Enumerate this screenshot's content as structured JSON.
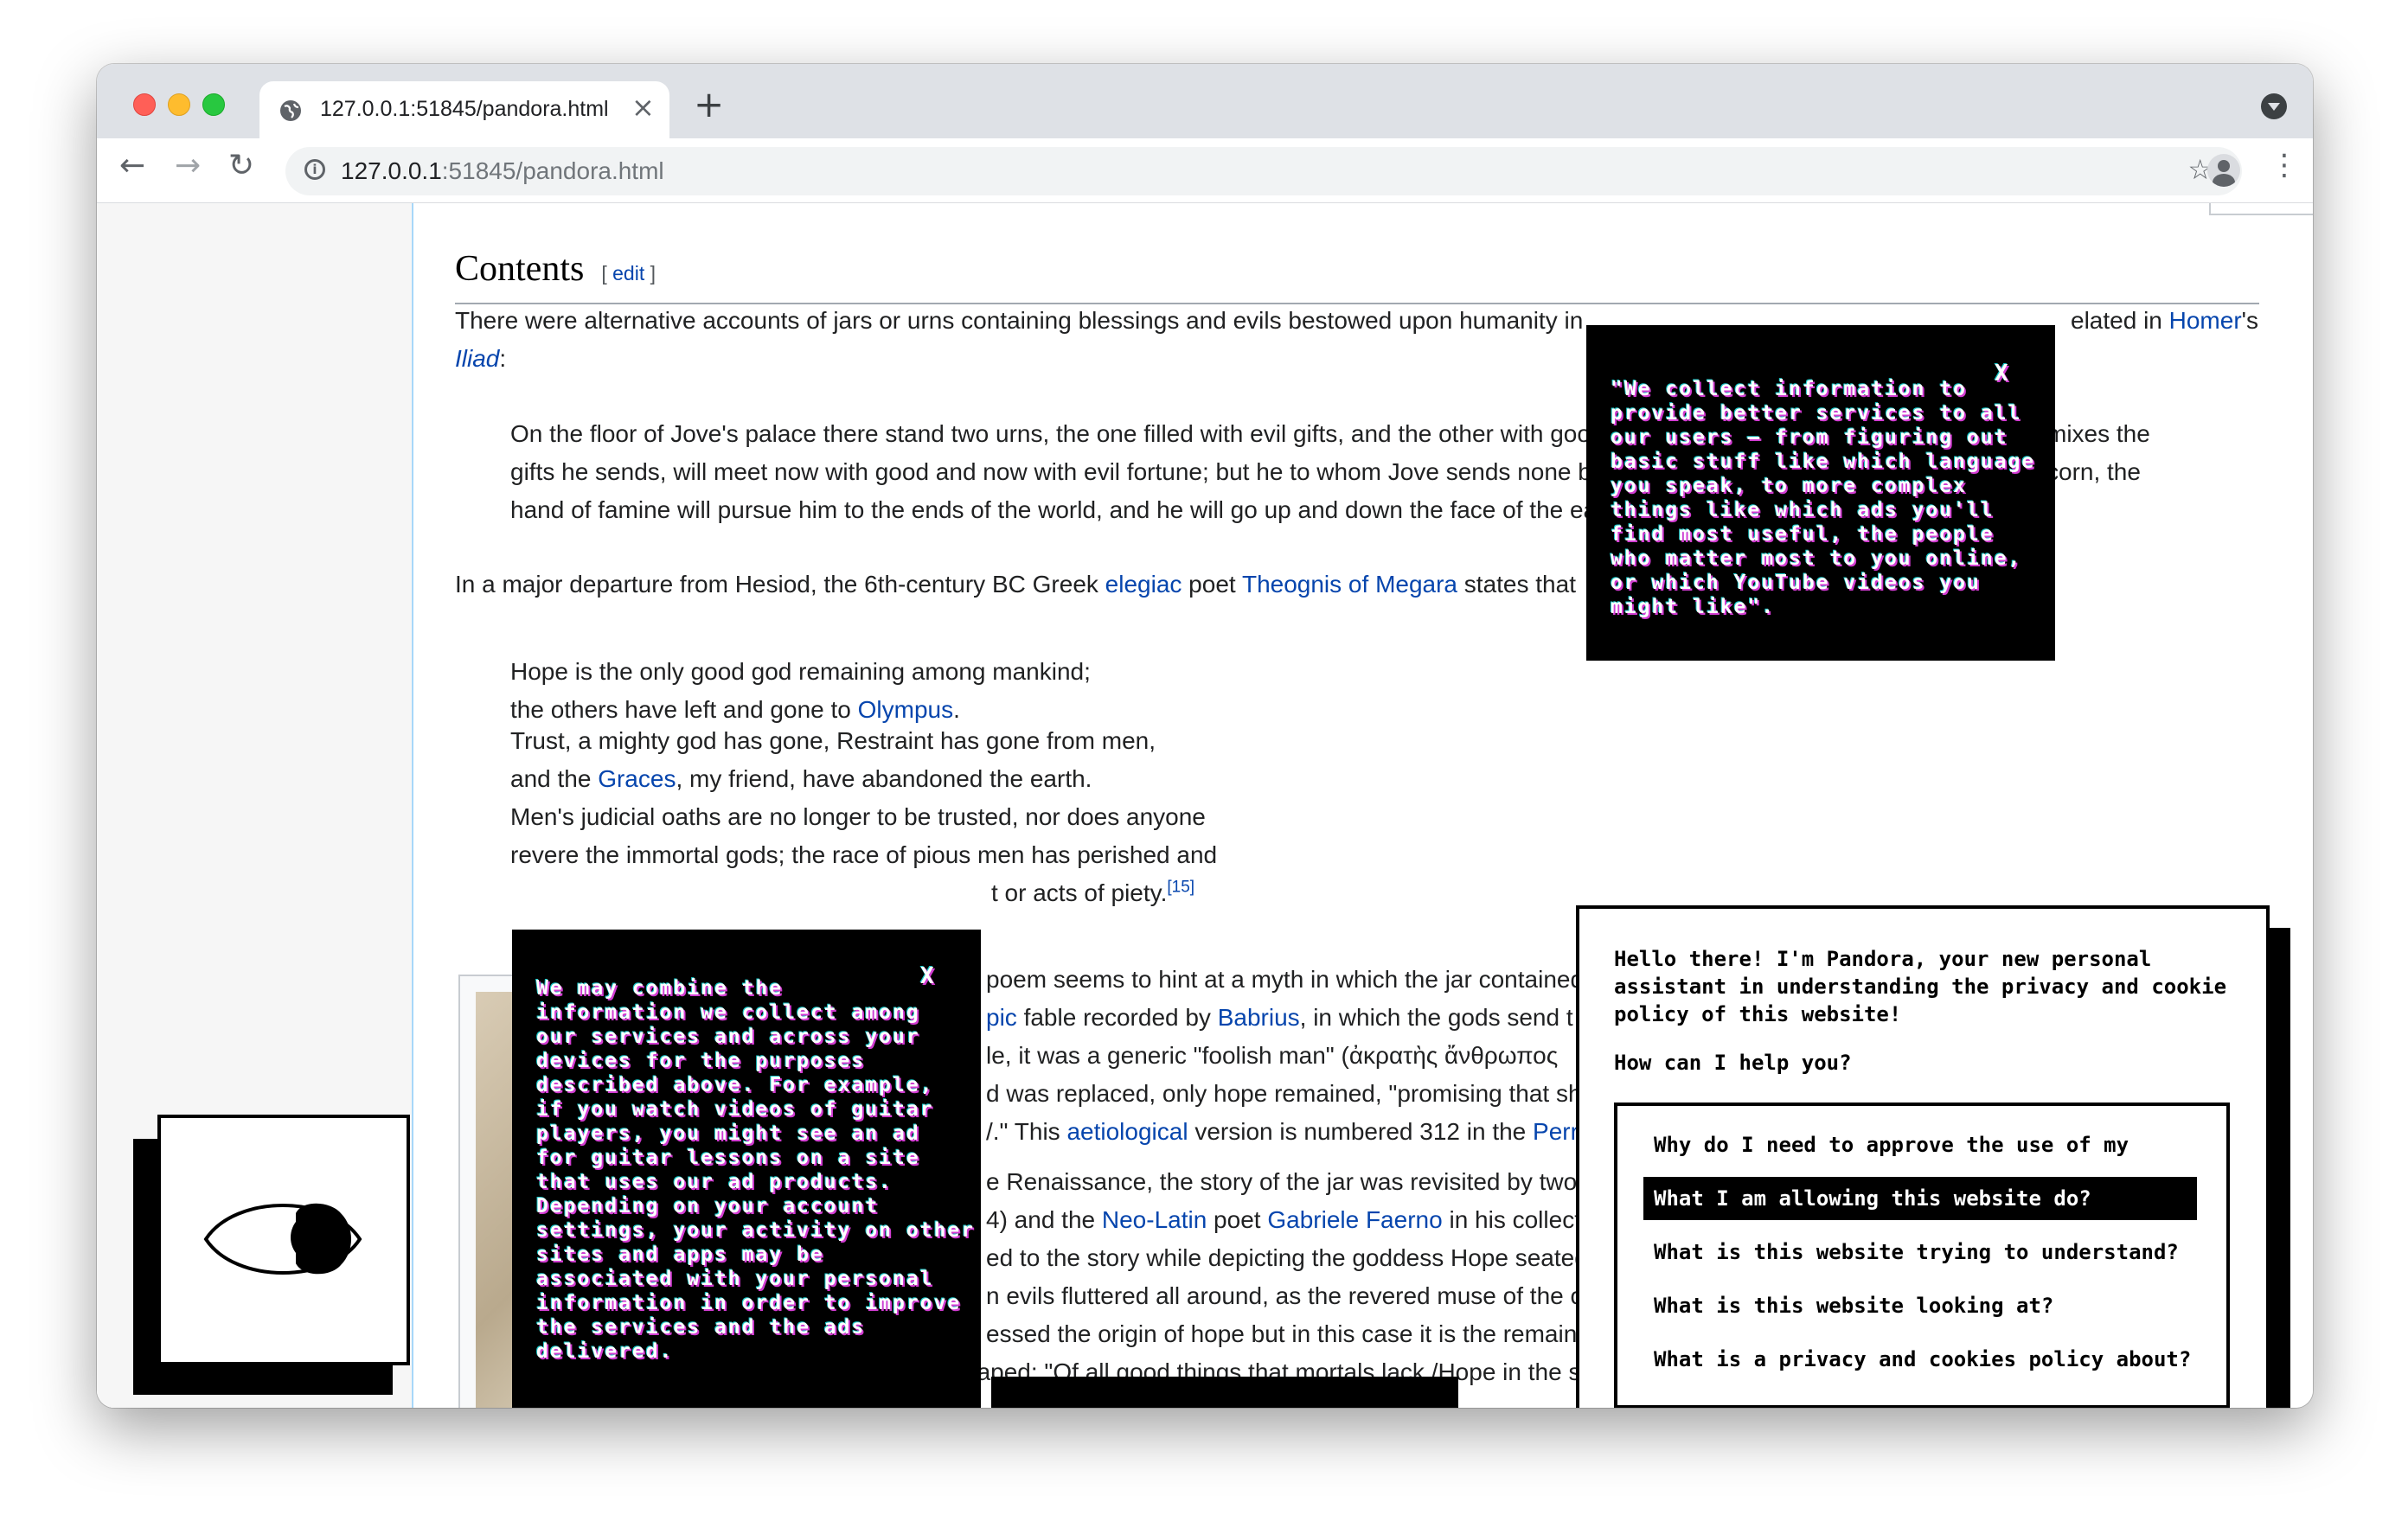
{
  "browser": {
    "tab_title": "127.0.0.1:51845/pandora.html",
    "url_host": "127.0.0.1",
    "url_path": ":51845/pandora.html"
  },
  "article": {
    "heading": "Contents",
    "edit": "[ edit ]",
    "p1_before": "There were alternative accounts of jars or urns containing blessings and evils bestowed upon humanity in ",
    "p1_link_homer": "Homer",
    "p1_mid": "elated in ",
    "p1_end": "'s",
    "p1_iliad": "Iliad",
    "p1_colon": ":",
    "q1_line1": "On the floor of Jove's palace there stand two urns, the one filled with evil gifts, and the other with goo",
    "q1_line1_end": "mixes the",
    "q1_line2": "gifts he sends, will meet now with good and now with evil fortune; but he to whom Jove sends none b",
    "q1_line2_end": "corn, the",
    "q1_line3": "hand of famine will pursue him to the ends of the world, and he will go up and down the face of the ea",
    "p2_before": "In a major departure from Hesiod, the 6th-century BC Greek ",
    "p2_elegiac": "elegiac",
    "p2_mid": " poet ",
    "p2_theognis": "Theognis of Megara",
    "p2_end": " states that",
    "poem1": "Hope is the only good god remaining among mankind;",
    "poem2_before": "the others have left and gone to ",
    "poem2_link": "Olympus",
    "poem2_end": ".",
    "poem3": "Trust, a mighty god has gone, Restraint has gone from men,",
    "poem4_before": "and the ",
    "poem4_link": "Graces",
    "poem4_end": ", my friend, have abandoned the earth.",
    "poem5": "Men's judicial oaths are no longer to be trusted, nor does anyone",
    "poem6": "revere the immortal gods; the race of pious men has perished and",
    "poem7": "t or acts of piety.",
    "poem7_ref": "[15]",
    "r1": "poem seems to hint at a myth in which the jar contained",
    "r2_link1": "pic",
    "r2_mid": " fable recorded by ",
    "r2_link2": "Babrius",
    "r2_end": ", in which the gods send t",
    "r3": "le, it was a generic \"foolish man\" (ἀκρατὴς ἄνθρωπος",
    "r4": "d was replaced, only hope remained, \"promising that sh",
    "r5_before": "/.\" This ",
    "r5_link": "aetiological",
    "r5_mid": " version is numbered 312 in the ",
    "r5_link2": "Perr",
    "r6": "e Renaissance, the story of the jar was revisited by two",
    "r7_before": "4) and the ",
    "r7_link1": "Neo-Latin",
    "r7_mid": " poet ",
    "r7_link2": "Gabriele Faerno",
    "r7_end": " in his collect",
    "r8": "ed to the story while depicting the goddess Hope seated",
    "r9": "n evils fluttered all around, as the revered muse of the o",
    "r10": "essed the origin of hope but in this case it is the remain",
    "r11": "escaped: \"Of all good things that mortals lack./Hope in the se"
  },
  "popup_top": {
    "close": "X",
    "text": "\"We collect information to\nprovide better services to all\nour users — from figuring out\nbasic stuff like which language\nyou speak, to more complex\nthings like which ads you'll\nfind most useful, the people\nwho matter most to you online,\nor which YouTube videos you\nmight like\"."
  },
  "popup_left": {
    "close": "X",
    "text": "We may combine the\ninformation we collect among\nour services and across your\ndevices for the purposes\ndescribed above. For example,\nif you watch videos of guitar\nplayers, you might see an ad\nfor guitar lessons on a site\nthat uses our ad products.\nDepending on your account\nsettings, your activity on other\nsites and apps may be\nassociated with your personal\ninformation in order to improve\nthe services and the ads\ndelivered."
  },
  "pandora": {
    "greeting": "Hello there! I'm Pandora, your new personal assistant in understanding the privacy and cookie policy of this website!",
    "help": "How can I help you?",
    "options": [
      "Why do I need to approve the use of my data?",
      "What I am allowing this website do?",
      "What is this website trying to understand?",
      "What is this website looking at?",
      "What is a privacy and cookies policy about?"
    ],
    "active_index": 1
  }
}
